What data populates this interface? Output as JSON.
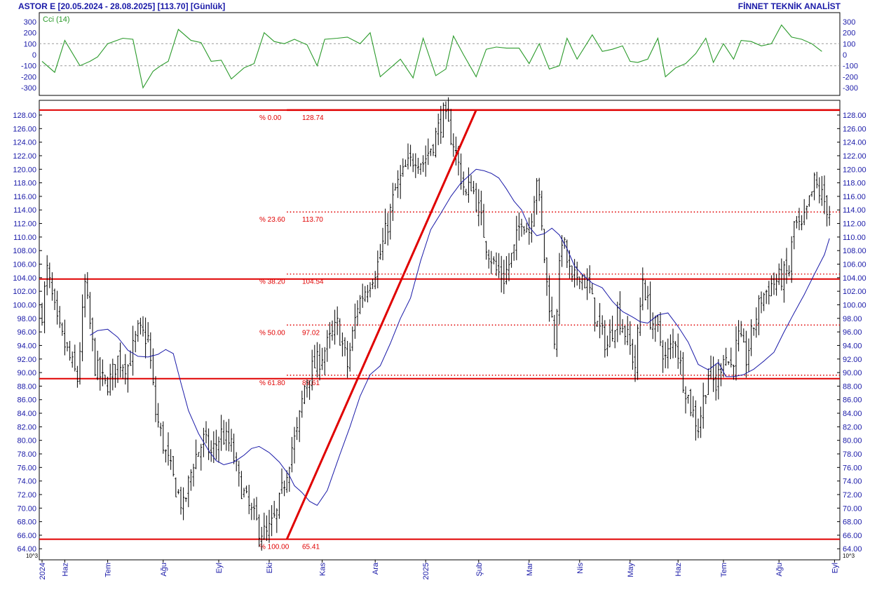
{
  "header": {
    "left_text": "ASTOR E  [20.05.2024 - 28.08.2025]  [113.70]  [Günlük]",
    "right_text": "FİNNET TEKNİK ANALİST"
  },
  "colors": {
    "axis_text": "#1a1aa8",
    "cci_line": "#2a9a2a",
    "price_bar": "#000000",
    "moving_average": "#1a1aa8",
    "fib_lines": "#e00000",
    "trend_line": "#e00000"
  },
  "chart_data": [
    {
      "type": "line",
      "title": "Cci (14)",
      "ylim": [
        -400,
        400
      ],
      "y_ticks": [
        300,
        200,
        100,
        0,
        -100,
        -200,
        -300
      ],
      "reference_lines": [
        100,
        -100
      ],
      "x_index": [
        0,
        5,
        9,
        15,
        19,
        22,
        26,
        32,
        36,
        40,
        44,
        47,
        50,
        54,
        59,
        63,
        67,
        71,
        75,
        80,
        84,
        88,
        92,
        96,
        100,
        105,
        109,
        112,
        117,
        121,
        126,
        130,
        134,
        138,
        142,
        147,
        151,
        156,
        160,
        163,
        167,
        172,
        176,
        180,
        184,
        189,
        193,
        197,
        201,
        205,
        208,
        212,
        218,
        222,
        226,
        230,
        233,
        236,
        240,
        244,
        247,
        251,
        255,
        259,
        263,
        266,
        270,
        274,
        277,
        281,
        285,
        289,
        293,
        297,
        301,
        305,
        309
      ],
      "values": [
        -60,
        -160,
        130,
        -100,
        -60,
        -20,
        100,
        150,
        140,
        -300,
        -150,
        -100,
        -60,
        230,
        130,
        110,
        -60,
        -50,
        -220,
        -120,
        -80,
        200,
        120,
        100,
        140,
        90,
        -100,
        140,
        150,
        160,
        100,
        200,
        -200,
        -120,
        -40,
        -210,
        150,
        -190,
        -130,
        170,
        0,
        -200,
        50,
        70,
        60,
        60,
        -80,
        100,
        -130,
        -100,
        150,
        -40,
        180,
        30,
        50,
        80,
        -60,
        -70,
        -40,
        150,
        -200,
        -120,
        -80,
        10,
        150,
        -70,
        100,
        -40,
        130,
        120,
        80,
        100,
        270,
        160,
        140,
        100,
        30
      ]
    },
    {
      "type": "ohlc",
      "title": "",
      "ylim": [
        64,
        130
      ],
      "y_ticks": [
        128,
        126,
        124,
        122,
        120,
        118,
        116,
        114,
        112,
        110,
        108,
        106,
        104,
        102,
        100,
        98,
        96,
        94,
        92,
        90,
        88,
        86,
        84,
        82,
        80,
        78,
        76,
        74,
        72,
        70,
        68,
        66,
        64
      ],
      "y_tick_labels": [
        "128.00",
        "126.00",
        "124.00",
        "122.00",
        "120.00",
        "118.00",
        "116.00",
        "114.00",
        "112.00",
        "110.00",
        "108.00",
        "106.00",
        "104.00",
        "102.00",
        "100.00",
        "98.00",
        "96.00",
        "94.00",
        "92.00",
        "90.00",
        "88.00",
        "86.00",
        "84.00",
        "82.00",
        "80.00",
        "78.00",
        "76.00",
        "74.00",
        "72.00",
        "70.00",
        "68.00",
        "66.00",
        "64.00"
      ],
      "axis_badge": "10^3",
      "x_axis_labels": [
        {
          "label": "2024",
          "bar_index": 0
        },
        {
          "label": "Haz",
          "bar_index": 9
        },
        {
          "label": "Tem",
          "bar_index": 26
        },
        {
          "label": "Ağu",
          "bar_index": 48
        },
        {
          "label": "Eyl",
          "bar_index": 70
        },
        {
          "label": "Eki",
          "bar_index": 90
        },
        {
          "label": "Kas",
          "bar_index": 111
        },
        {
          "label": "Ara",
          "bar_index": 132
        },
        {
          "label": "2025",
          "bar_index": 152
        },
        {
          "label": "Şub",
          "bar_index": 173
        },
        {
          "label": "Mar",
          "bar_index": 193
        },
        {
          "label": "Nis",
          "bar_index": 213
        },
        {
          "label": "May",
          "bar_index": 233
        },
        {
          "label": "Haz",
          "bar_index": 252
        },
        {
          "label": "Tem",
          "bar_index": 270
        },
        {
          "label": "Ağu",
          "bar_index": 292
        },
        {
          "label": "Eyl",
          "bar_index": 314
        }
      ],
      "bar_count": 313,
      "close_anchor_index": [
        0,
        2,
        6,
        10,
        14,
        17,
        21,
        25,
        27,
        30,
        34,
        38,
        42,
        45,
        49,
        53,
        56,
        60,
        64,
        67,
        71,
        75,
        78,
        82,
        86,
        89,
        93,
        96,
        99,
        101,
        104,
        106,
        110,
        113,
        117,
        121,
        125,
        129,
        133,
        137,
        140,
        144,
        148,
        151,
        155,
        159,
        163,
        166,
        168,
        170,
        173,
        176,
        180,
        183,
        187,
        190,
        193,
        196,
        200,
        203,
        206,
        210,
        213,
        217,
        220,
        224,
        228,
        232,
        235,
        238,
        241,
        244,
        247,
        251,
        254,
        257,
        260,
        262,
        264,
        267,
        270,
        273,
        276,
        279,
        282,
        285,
        289,
        293,
        296,
        298,
        301,
        304,
        306,
        309,
        312
      ],
      "close_anchor_value": [
        99,
        105,
        97,
        93,
        89,
        103,
        91,
        88,
        89,
        92,
        91,
        96,
        95,
        84,
        78,
        73,
        70,
        77,
        80,
        78,
        81,
        79,
        74,
        70,
        67,
        66,
        69,
        74,
        79,
        81,
        88,
        90,
        92,
        94,
        97,
        91,
        100,
        103,
        106,
        112,
        117,
        120,
        122,
        121,
        124,
        128,
        124,
        119,
        116,
        118,
        114,
        109,
        105,
        104,
        108,
        113,
        111,
        119,
        103,
        95,
        110,
        103,
        105,
        102,
        97,
        94,
        99,
        95,
        91,
        104,
        98,
        96,
        92,
        95,
        89,
        85,
        82,
        86,
        90,
        88,
        93,
        91,
        95,
        92,
        97,
        101,
        103,
        104,
        105,
        112,
        111,
        115,
        118,
        116,
        113.7
      ],
      "moving_average_start_index": 19,
      "moving_average_anchor_index": [
        19,
        22,
        26,
        30,
        34,
        38,
        42,
        46,
        49,
        52,
        55,
        58,
        62,
        66,
        69,
        72,
        76,
        80,
        83,
        86,
        90,
        94,
        98,
        100,
        103,
        106,
        109,
        113,
        118,
        122,
        126,
        130,
        134,
        138,
        142,
        146,
        150,
        154,
        158,
        162,
        166,
        169,
        172,
        175,
        178,
        181,
        184,
        187,
        190,
        193,
        196,
        199,
        202,
        205,
        208,
        211,
        214,
        218,
        222,
        226,
        230,
        234,
        237,
        240,
        244,
        248,
        252,
        256,
        260,
        264,
        268,
        271,
        274,
        278,
        282,
        286,
        290,
        294,
        298,
        302,
        306,
        310,
        312
      ],
      "moving_average_anchor_value": [
        95.5,
        96.2,
        96.4,
        95.2,
        93.3,
        92.4,
        92.3,
        92.7,
        93.4,
        92.8,
        88.5,
        84.4,
        81.0,
        78.5,
        77.0,
        76.4,
        76.8,
        77.8,
        78.8,
        79.1,
        78.2,
        76.8,
        74.8,
        73.3,
        72.3,
        71.0,
        70.4,
        72.6,
        77.9,
        82.0,
        86.5,
        89.7,
        91.0,
        94.3,
        98.0,
        101.0,
        106.5,
        111.1,
        113.5,
        116.0,
        118.0,
        119.0,
        120.0,
        119.8,
        119.4,
        118.7,
        117.1,
        115.3,
        114.0,
        111.5,
        110.2,
        110.5,
        111.3,
        110.3,
        108.3,
        105.7,
        104.5,
        103.2,
        102.5,
        100.5,
        99.0,
        98.2,
        97.5,
        97.3,
        98.5,
        98.8,
        96.8,
        94.5,
        91.2,
        90.4,
        91.5,
        89.4,
        89.4,
        89.7,
        90.5,
        91.7,
        93.0,
        96.0,
        98.8,
        101.5,
        104.5,
        107.4,
        109.8
      ],
      "fibonacci": {
        "start_bar_index": 97,
        "end_bar_index": 172,
        "levels": [
          {
            "percent_label": "% 0.00",
            "value": 128.74,
            "value_label": "128.74"
          },
          {
            "percent_label": "% 23.60",
            "value": 113.7,
            "value_label": "113.70"
          },
          {
            "percent_label": "% 38.20",
            "value": 104.54,
            "value_label": "104.54"
          },
          {
            "percent_label": "% 50.00",
            "value": 97.02,
            "value_label": "97.02"
          },
          {
            "percent_label": "% 61.80",
            "value": 89.61,
            "value_label": "89.61"
          },
          {
            "percent_label": "% 100.00",
            "value": 65.41,
            "value_label": "65.41"
          }
        ],
        "full_width_lines": [
          128.74,
          103.8,
          89.1,
          65.41
        ]
      },
      "trend_line": {
        "from_bar_index": 97,
        "from_value": 65.41,
        "to_bar_index": 172,
        "to_value": 128.74
      }
    }
  ]
}
